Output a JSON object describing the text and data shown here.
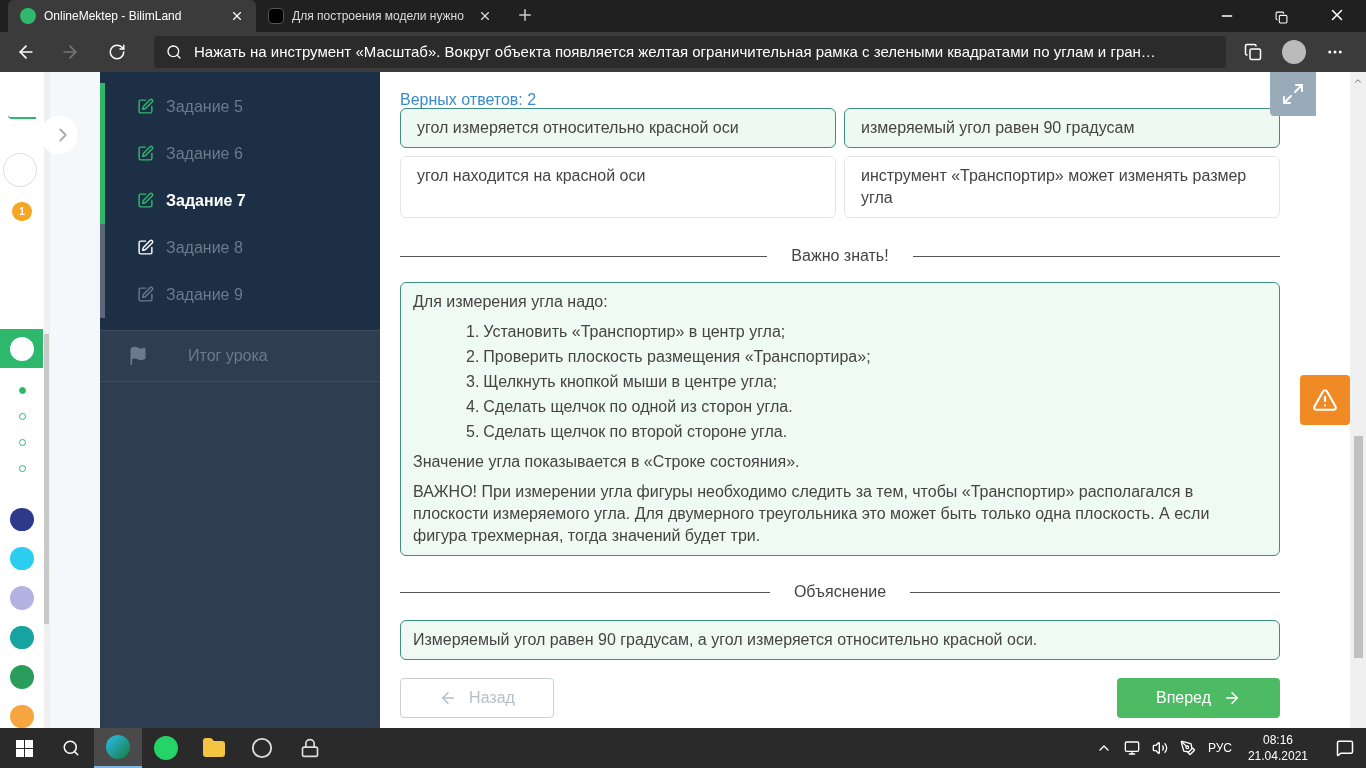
{
  "browser": {
    "tabs": [
      {
        "title": "OnlineMektep - BilimLand",
        "selected": true,
        "kind": "bilimland"
      },
      {
        "title": "Для построения модели нужно",
        "selected": false,
        "kind": "znanija"
      }
    ],
    "address": "Нажать на инструмент «Масштаб». Вокруг объекта появляется желтая ограничительная рамка с зелеными квадратами по углам и гран…"
  },
  "rail": {
    "badge": "1",
    "dots": [
      {
        "selected": true
      },
      {
        "selected": false
      },
      {
        "selected": false
      },
      {
        "selected": false
      }
    ]
  },
  "sidebar": {
    "items": [
      {
        "label": "Задание 5",
        "done": true,
        "locked": false,
        "selected": false
      },
      {
        "label": "Задание 6",
        "done": true,
        "locked": false,
        "selected": false
      },
      {
        "label": "Задание 7",
        "done": true,
        "locked": false,
        "selected": true
      },
      {
        "label": "Задание 8",
        "done": false,
        "locked": false,
        "selected": false
      },
      {
        "label": "Задание 9",
        "done": false,
        "locked": true,
        "selected": false
      }
    ],
    "summary": "Итог урока"
  },
  "main": {
    "score": "Верных ответов: 2",
    "answers": [
      {
        "text": "угол измеряется относительно красной оси",
        "correct": true
      },
      {
        "text": "измеряемый угол равен 90 градусам",
        "correct": true
      },
      {
        "text": "угол находится на красной оси",
        "correct": false
      },
      {
        "text": "инструмент «Транспортир» может изменять размер угла",
        "correct": false
      }
    ],
    "info_heading": "Важно знать!",
    "info": {
      "intro": "Для измерения угла надо:",
      "steps": [
        {
          "number": "1.",
          "text": "Установить «Транспортир» в центр угла;"
        },
        {
          "number": "2.",
          "text": "Проверить плоскость размещения «Транспортира»;"
        },
        {
          "number": "3.",
          "text": "Щелкнуть кнопкой мыши в центре угла;"
        },
        {
          "number": "4.",
          "text": "Сделать щелчок по одной из сторон угла."
        },
        {
          "number": "5.",
          "text": "Сделать щелчок по второй стороне угла."
        }
      ],
      "paragraphs": [
        "Значение угла показывается в «Строке состояния».",
        "ВАЖНО! При измерении угла фигуры необходимо следить за тем, чтобы «Транспортир» располагался в плоскости измеряемого угла. Для двумерного треугольника это может быть только одна плоскость. А если фигура трехмерная, тогда значений будет три."
      ]
    },
    "explanation_heading": "Объяснение",
    "explanation": "Измеряемый угол равен 90 градусам, а угол измеряется относительно красной оси.",
    "back_button": "Назад",
    "next_button": "Вперед"
  },
  "taskbar": {
    "apps": [
      {
        "kind": "edge",
        "selected": true
      },
      {
        "kind": "whatsapp",
        "selected": false
      },
      {
        "kind": "explorer",
        "selected": false
      },
      {
        "kind": "obs",
        "selected": false
      },
      {
        "kind": "vpn",
        "selected": false
      }
    ],
    "language": "РУС",
    "time": "08:16",
    "date": "21.04.2021"
  }
}
